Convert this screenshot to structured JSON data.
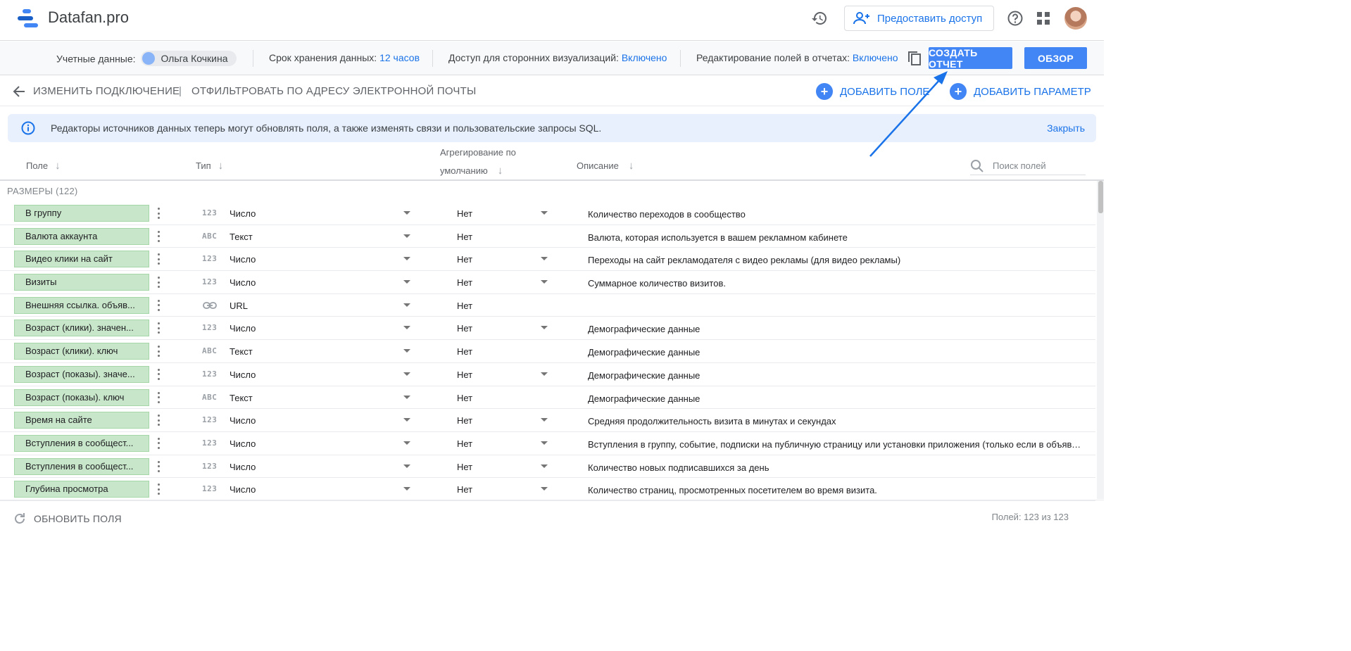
{
  "app": {
    "title": "Datafan.pro",
    "share_label": "Предоставить доступ"
  },
  "subbar": {
    "credentials_label": "Учетные данные:",
    "credentials_user": "Ольга Кочкина",
    "retention_label": "Срок хранения данных:",
    "retention_value": "12 часов",
    "third_party_label": "Доступ для сторонних визуализаций:",
    "third_party_value": "Включено",
    "field_edit_label": "Редактирование полей в отчетах:",
    "field_edit_value": "Включено",
    "create_report": "СОЗДАТЬ ОТЧЕТ",
    "overview": "ОБЗОР"
  },
  "actions": {
    "edit_connection": "ИЗМЕНИТЬ ПОДКЛЮЧЕНИЕ",
    "separator": "|",
    "filter_email": "ОТФИЛЬТРОВАТЬ ПО АДРЕСУ ЭЛЕКТРОННОЙ ПОЧТЫ",
    "add_field": "ДОБАВИТЬ ПОЛЕ",
    "add_param": "ДОБАВИТЬ ПАРАМЕТР"
  },
  "banner": {
    "text": "Редакторы источников данных теперь могут обновлять поля, а также изменять связи и пользовательские запросы SQL.",
    "close": "Закрыть"
  },
  "table": {
    "col_field": "Поле",
    "col_type": "Тип",
    "col_agg_line1": "Агрегирование по",
    "col_agg_line2": "умолчанию",
    "col_desc": "Описание",
    "search_placeholder": "Поиск полей",
    "section_label": "РАЗМЕРЫ (122)",
    "rows": [
      {
        "field": "В группу",
        "type_icon": "123",
        "type": "Число",
        "agg": "Нет",
        "agg_dd": true,
        "desc": "Количество переходов в сообщество"
      },
      {
        "field": "Валюта аккаунта",
        "type_icon": "ABC",
        "type": "Текст",
        "agg": "Нет",
        "agg_dd": false,
        "desc": "Валюта, которая используется в вашем рекламном кабинете"
      },
      {
        "field": "Видео клики на сайт",
        "type_icon": "123",
        "type": "Число",
        "agg": "Нет",
        "agg_dd": true,
        "desc": "Переходы на сайт рекламодателя с видео рекламы (для видео рекламы)"
      },
      {
        "field": "Визиты",
        "type_icon": "123",
        "type": "Число",
        "agg": "Нет",
        "agg_dd": true,
        "desc": "Суммарное количество визитов."
      },
      {
        "field": "Внешняя ссылка. объяв...",
        "type_icon": "link",
        "type": "URL",
        "agg": "Нет",
        "agg_dd": false,
        "desc": ""
      },
      {
        "field": "Возраст (клики). значен...",
        "type_icon": "123",
        "type": "Число",
        "agg": "Нет",
        "agg_dd": true,
        "desc": "Демографические данные"
      },
      {
        "field": "Возраст (клики). ключ",
        "type_icon": "ABC",
        "type": "Текст",
        "agg": "Нет",
        "agg_dd": false,
        "desc": "Демографические данные"
      },
      {
        "field": "Возраст (показы). значе...",
        "type_icon": "123",
        "type": "Число",
        "agg": "Нет",
        "agg_dd": true,
        "desc": "Демографические данные"
      },
      {
        "field": "Возраст (показы). ключ",
        "type_icon": "ABC",
        "type": "Текст",
        "agg": "Нет",
        "agg_dd": false,
        "desc": "Демографические данные"
      },
      {
        "field": "Время на сайте",
        "type_icon": "123",
        "type": "Число",
        "agg": "Нет",
        "agg_dd": true,
        "desc": "Средняя продолжительность визита в минутах и секундах"
      },
      {
        "field": "Вступления в сообщест...",
        "type_icon": "123",
        "type": "Число",
        "agg": "Нет",
        "agg_dd": true,
        "desc": "Вступления в группу, событие, подписки на публичную страницу или установки приложения (только если в объявлении..."
      },
      {
        "field": "Вступления в сообщест...",
        "type_icon": "123",
        "type": "Число",
        "agg": "Нет",
        "agg_dd": true,
        "desc": "Количество новых подписавшихся за день"
      },
      {
        "field": "Глубина просмотра",
        "type_icon": "123",
        "type": "Число",
        "agg": "Нет",
        "agg_dd": true,
        "desc": "Количество страниц, просмотренных посетителем во время визита."
      }
    ]
  },
  "footer": {
    "refresh": "ОБНОВИТЬ ПОЛЯ",
    "count": "Полей: 123 из 123"
  },
  "colors": {
    "accent": "#1a73e8",
    "primary_button": "#4285f4",
    "dimension_chip": "#c8e6c9",
    "banner_bg": "#e8f0fe"
  }
}
